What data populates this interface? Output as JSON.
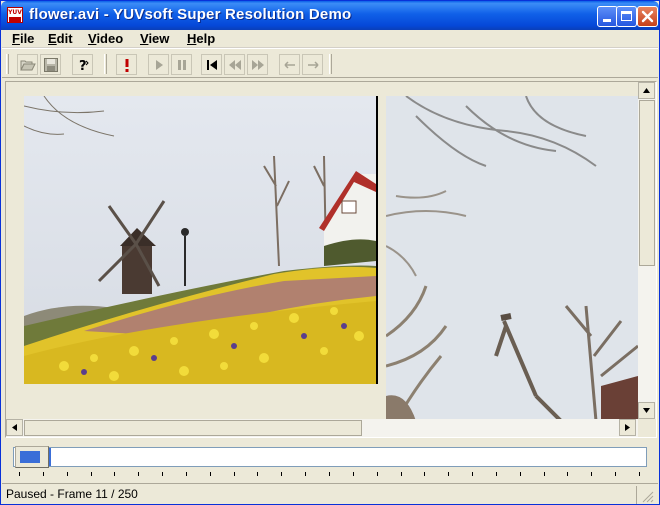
{
  "window": {
    "title": "flower.avi - YUVsoft Super Resolution Demo",
    "app_icon_text": "YUV"
  },
  "menu": {
    "items": [
      {
        "label": "File",
        "key": "F",
        "rest": "ile"
      },
      {
        "label": "Edit",
        "key": "E",
        "rest": "dit"
      },
      {
        "label": "Video",
        "key": "V",
        "rest": "ideo"
      },
      {
        "label": "View",
        "key": "V",
        "rest": "iew"
      },
      {
        "label": "Help",
        "key": "H",
        "rest": "elp"
      }
    ]
  },
  "toolbar": {
    "buttons": [
      {
        "name": "open-button",
        "icon": "folder-open-icon"
      },
      {
        "name": "save-button",
        "icon": "floppy-disk-icon"
      },
      {
        "name": "help-button",
        "icon": "help-question-icon"
      },
      {
        "name": "process-button",
        "icon": "exclamation-icon"
      },
      {
        "name": "play-button",
        "icon": "play-icon"
      },
      {
        "name": "pause-button",
        "icon": "pause-icon"
      },
      {
        "name": "first-frame-button",
        "icon": "skip-to-start-icon"
      },
      {
        "name": "rewind-button",
        "icon": "rewind-icon"
      },
      {
        "name": "fast-forward-button",
        "icon": "fast-forward-icon"
      },
      {
        "name": "previous-frame-button",
        "icon": "arrow-left-icon"
      },
      {
        "name": "next-frame-button",
        "icon": "arrow-right-icon"
      }
    ]
  },
  "views": {
    "left": "original-video-frame",
    "right": "super-resolution-zoomed-frame"
  },
  "seek": {
    "current_frame": 11,
    "total_frames": 250
  },
  "status": {
    "text": "Paused - Frame 11 / 250"
  },
  "colors": {
    "titlebar": "#0a5fe8",
    "accent": "#3a6ed8",
    "process_icon": "#c00000",
    "face": "#ece9d8"
  }
}
